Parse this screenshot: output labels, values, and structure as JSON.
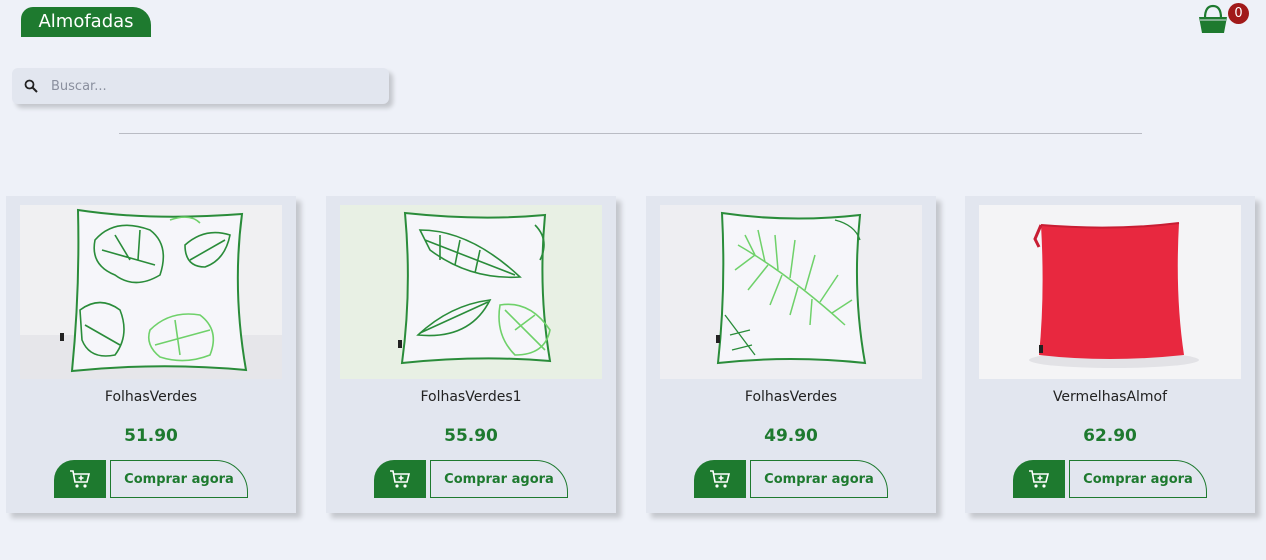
{
  "header": {
    "brand": "Almofadas",
    "cart_count": "0",
    "cart_icon": "shopping-basket-icon"
  },
  "search": {
    "placeholder": "Buscar...",
    "icon": "search-icon"
  },
  "products": [
    {
      "name": "FolhasVerdes",
      "price": "51.90",
      "buy_label": "Comprar agora",
      "image": "white-cushion-green-monstera-leaves"
    },
    {
      "name": "FolhasVerdes1",
      "price": "55.90",
      "buy_label": "Comprar agora",
      "image": "white-cushion-green-banana-leaves"
    },
    {
      "name": "FolhasVerdes",
      "price": "49.90",
      "buy_label": "Comprar agora",
      "image": "white-cushion-green-fern-leaf"
    },
    {
      "name": "VermelhasAlmof",
      "price": "62.90",
      "buy_label": "Comprar agora",
      "image": "plain-red-cushion"
    }
  ],
  "colors": {
    "accent": "#1e7a2f",
    "badge": "#a11a1a",
    "background": "#eef1f8",
    "card": "#e2e6ef"
  }
}
